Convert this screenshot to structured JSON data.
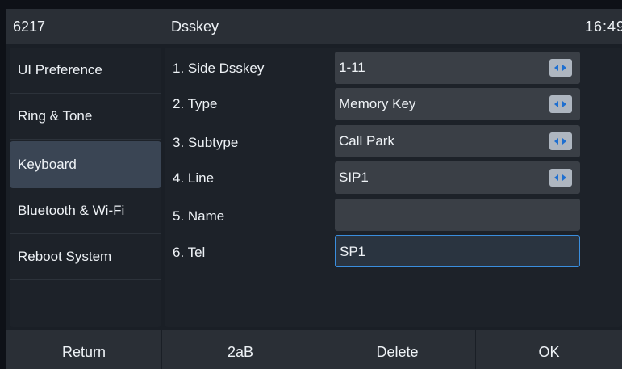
{
  "status_bar": {
    "extension": "6217",
    "title": "Dsskey",
    "time": "16:49"
  },
  "sidebar": {
    "items": [
      {
        "label": "UI Preference",
        "active": false
      },
      {
        "label": "Ring & Tone",
        "active": false
      },
      {
        "label": "Keyboard",
        "active": true
      },
      {
        "label": "Bluetooth & Wi-Fi",
        "active": false
      },
      {
        "label": "Reboot System",
        "active": false
      }
    ]
  },
  "form": {
    "side_dsskey": {
      "label": "1. Side Dsskey",
      "value": "1-11"
    },
    "type": {
      "label": "2. Type",
      "value": "Memory Key"
    },
    "subtype": {
      "label": "3. Subtype",
      "value": "Call Park"
    },
    "line": {
      "label": "4. Line",
      "value": "SIP1"
    },
    "name": {
      "label": "5. Name",
      "value": ""
    },
    "tel": {
      "label": "6. Tel",
      "value": "SP1"
    }
  },
  "softkeys": {
    "return": "Return",
    "input_mode": "2aB",
    "delete": "Delete",
    "ok": "OK"
  },
  "colors": {
    "accent": "#3a8ede",
    "arrow_icon": "#1e6fd0",
    "active_menu": "#3a4554"
  },
  "icons": {
    "selector": "left-right-arrow-icon"
  }
}
